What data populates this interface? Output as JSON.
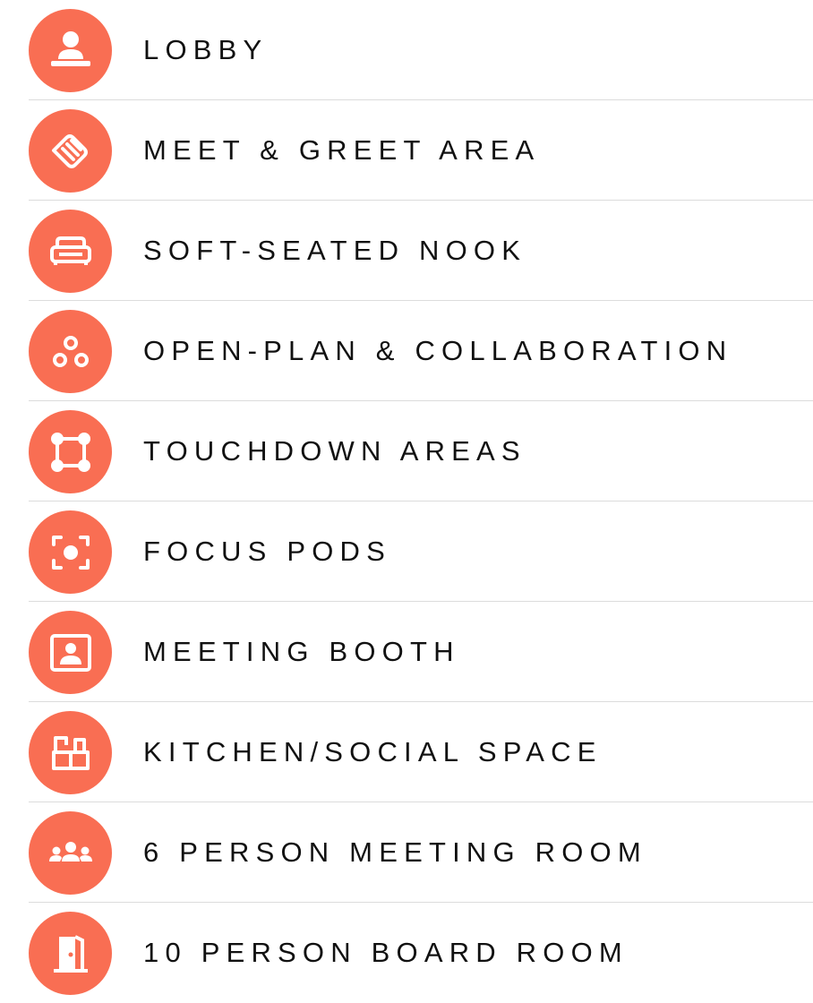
{
  "accent_color": "#F96E53",
  "items": [
    {
      "label": "LOBBY",
      "icon": "reception-person-icon"
    },
    {
      "label": "MEET & GREET AREA",
      "icon": "handshake-icon"
    },
    {
      "label": "SOFT-SEATED NOOK",
      "icon": "sofa-icon"
    },
    {
      "label": "OPEN-PLAN & COLLABORATION",
      "icon": "three-circles-icon"
    },
    {
      "label": "TOUCHDOWN AREAS",
      "icon": "square-nodes-icon"
    },
    {
      "label": "FOCUS PODS",
      "icon": "focus-frame-icon"
    },
    {
      "label": "MEETING BOOTH",
      "icon": "person-screen-icon"
    },
    {
      "label": "KITCHEN/SOCIAL SPACE",
      "icon": "kitchen-icon"
    },
    {
      "label": "6 PERSON MEETING ROOM",
      "icon": "group-people-icon"
    },
    {
      "label": "10 PERSON BOARD ROOM",
      "icon": "door-icon"
    }
  ]
}
